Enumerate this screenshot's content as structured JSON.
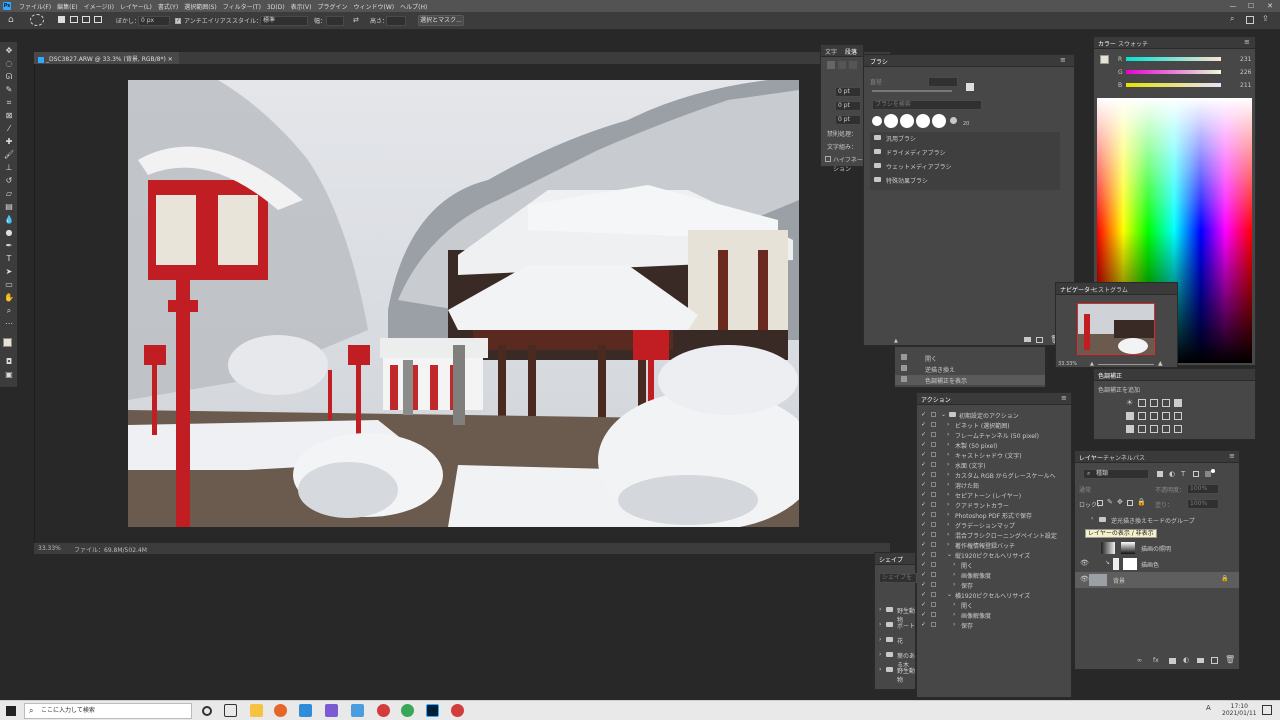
{
  "menubar": {
    "items": [
      "ファイル(F)",
      "編集(E)",
      "イメージ(I)",
      "レイヤー(L)",
      "書式(Y)",
      "選択範囲(S)",
      "フィルター(T)",
      "3D(D)",
      "表示(V)",
      "プラグイン",
      "ウィンドウ(W)",
      "ヘルプ(H)"
    ],
    "minimize": "—",
    "maximize": "☐",
    "close": "✕"
  },
  "optbar": {
    "feather_label": "ぼかし：",
    "feather_value": "0 px",
    "antialias_label": "アンチエイリアス",
    "style_label": "スタイル：",
    "style_value": "標準",
    "width_label": "幅：",
    "height_label": "高さ：",
    "select_mask_button": "選択とマスク..."
  },
  "document": {
    "tab_title": "_DSC3827.ARW @ 33.3% (背景, RGB/8*)",
    "zoom": "33.33%",
    "file_info": "ファイル：69.8M/502.4M"
  },
  "paragraph_panel": {
    "tabs": [
      "文字",
      "段落"
    ],
    "indent_values": [
      "0 pt",
      "0 pt",
      "0 pt"
    ],
    "rows": [
      "禁則処理：",
      "文字組み：",
      "ハイフネーション"
    ]
  },
  "brush_panel": {
    "title": "ブラシ",
    "size_label": "直径",
    "search_placeholder": "ブラシを検索",
    "brush_size_text": "20",
    "folders": [
      "汎用ブラシ",
      "ドライメディアブラシ",
      "ウェットメディアブラシ",
      "特殊効果ブラシ"
    ]
  },
  "color_panel": {
    "tabs": [
      "カラー",
      "スウォッチ"
    ],
    "r_label": "R",
    "r_value": "231",
    "g_label": "G",
    "g_value": "226",
    "b_label": "B",
    "b_value": "211"
  },
  "navigator_panel": {
    "tabs": [
      "ナビゲーター",
      "ヒストグラム"
    ],
    "zoom": "33.33%"
  },
  "history_panel": {
    "rows": [
      "開く",
      "逆描き換え",
      "色調補正を表示"
    ]
  },
  "adjust_panel": {
    "title": "色調補正",
    "add_label": "色調補正を追加"
  },
  "actions_panel": {
    "title": "アクション",
    "rows": [
      {
        "label": "初期設定のアクション",
        "indent": 1,
        "folder": true,
        "expanded": true
      },
      {
        "label": "ビネット (選択範囲)",
        "indent": 2
      },
      {
        "label": "フレームチャンネル (50 pixel)",
        "indent": 2
      },
      {
        "label": "木製 (50 pixel)",
        "indent": 2
      },
      {
        "label": "キャストシャドウ (文字)",
        "indent": 2
      },
      {
        "label": "水面 (文字)",
        "indent": 2
      },
      {
        "label": "カスタム RGB からグレースケールへ",
        "indent": 2
      },
      {
        "label": "溶けた鉛",
        "indent": 2
      },
      {
        "label": "セピアトーン (レイヤー)",
        "indent": 2
      },
      {
        "label": "クアドラントカラー",
        "indent": 2
      },
      {
        "label": "Photoshop PDF 形式で保存",
        "indent": 2
      },
      {
        "label": "グラデーションマップ",
        "indent": 2
      },
      {
        "label": "混合ブラシクローニングペイント設定",
        "indent": 2
      },
      {
        "label": "著作権情報登録バッチ",
        "indent": 2
      },
      {
        "label": "縦1920ピクセルへリサイズ",
        "indent": 2,
        "expanded": true
      },
      {
        "label": "開く",
        "indent": 3
      },
      {
        "label": "画像解像度",
        "indent": 3
      },
      {
        "label": "保存",
        "indent": 3
      },
      {
        "label": "横1920ピクセルへリサイズ",
        "indent": 2,
        "expanded": true
      },
      {
        "label": "開く",
        "indent": 3
      },
      {
        "label": "画像解像度",
        "indent": 3
      },
      {
        "label": "保存",
        "indent": 3
      }
    ]
  },
  "shapes_panel": {
    "title": "シェイプ",
    "search_placeholder": "シェイプを検索",
    "folders": [
      "野生動物",
      "ボート",
      "花",
      "葉のある木",
      "野生動物"
    ]
  },
  "layers_panel": {
    "tabs": [
      "レイヤー",
      "チャンネル",
      "パス"
    ],
    "kind_label": "種類",
    "mode": "通常",
    "opacity_label": "不透明度：",
    "opacity_value": "100%",
    "lock_label": "ロック：",
    "fill_label": "塗り：",
    "fill_value": "100%",
    "group_name": "逆光描き換えモードのグループ",
    "tooltip": "レイヤーの表示 / 非表示",
    "layers": [
      "描画の照明",
      "描画色",
      "背景"
    ]
  },
  "taskbar": {
    "search_placeholder": "ここに入力して検索",
    "time": "17:10",
    "date": "2021/01/11",
    "ime": "A"
  }
}
